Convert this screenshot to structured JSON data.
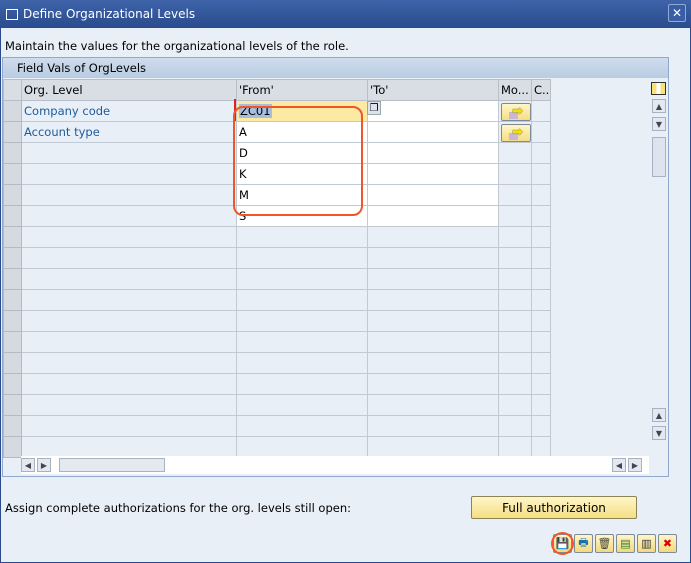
{
  "window": {
    "title": "Define Organizational Levels",
    "close_label": "✕"
  },
  "instruction": "Maintain the values for the organizational levels of the role.",
  "group": {
    "title": "Field Vals of OrgLevels"
  },
  "table": {
    "columns": [
      "Org. Level",
      "'From'",
      "'To'",
      "Mo...",
      "C.."
    ],
    "rows": [
      {
        "org_level": "Company code",
        "from": "ZC01",
        "to": "",
        "has_button": true
      },
      {
        "org_level": "Account type",
        "from": "A",
        "to": "",
        "has_button": true
      },
      {
        "org_level": "",
        "from": "D",
        "to": "",
        "has_button": false
      },
      {
        "org_level": "",
        "from": "K",
        "to": "",
        "has_button": false
      },
      {
        "org_level": "",
        "from": "M",
        "to": "",
        "has_button": false
      },
      {
        "org_level": "",
        "from": "S",
        "to": "",
        "has_button": false
      }
    ],
    "empty_rows": 11
  },
  "footer": {
    "assign_text": "Assign complete authorizations for the org. levels still open:",
    "full_auth_label": "Full authorization"
  },
  "toolbar": [
    {
      "name": "save-icon",
      "glyph": "💾"
    },
    {
      "name": "print-icon",
      "glyph": "🖶"
    },
    {
      "name": "delete-icon",
      "glyph": "🗑"
    },
    {
      "name": "select-all-icon",
      "glyph": "▤"
    },
    {
      "name": "deselect-all-icon",
      "glyph": "▥"
    },
    {
      "name": "cancel-icon",
      "glyph": "✖"
    }
  ],
  "colors": {
    "title_bar": "#2a4c8e",
    "highlight_ring": "#f0562a",
    "button_yellow": "#f6de85"
  }
}
